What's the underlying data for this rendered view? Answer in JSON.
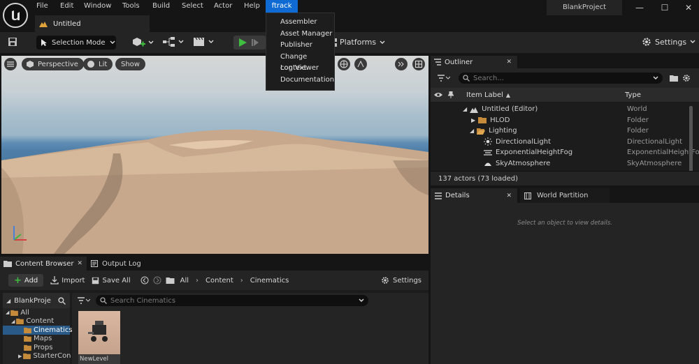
{
  "menu": {
    "items": [
      "File",
      "Edit",
      "Window",
      "Tools",
      "Build",
      "Select",
      "Actor",
      "Help",
      "ftrack"
    ],
    "active": "ftrack"
  },
  "tab": {
    "title": "Untitled"
  },
  "project": {
    "name": "BlankProject"
  },
  "toolbar": {
    "selection_mode": "Selection Mode",
    "platforms": "Platforms",
    "settings": "Settings"
  },
  "viewport": {
    "perspective": "Perspective",
    "lit": "Lit",
    "show": "Show"
  },
  "ftrack_menu": {
    "items": [
      "Assembler",
      "Asset Manager",
      "Publisher",
      "Change context",
      "Log Viewer",
      "Documentation"
    ]
  },
  "outliner": {
    "tab": "Outliner",
    "search_placeholder": "Search...",
    "col_label": "Item Label",
    "col_type": "Type",
    "rows": [
      {
        "label": "Untitled (Editor)",
        "type": "World"
      },
      {
        "label": "HLOD",
        "type": "Folder"
      },
      {
        "label": "Lighting",
        "type": "Folder"
      },
      {
        "label": "DirectionalLight",
        "type": "DirectionalLight"
      },
      {
        "label": "ExponentialHeightFog",
        "type": "ExponentialHeightFo"
      },
      {
        "label": "SkyAtmosphere",
        "type": "SkyAtmosphere"
      }
    ],
    "status": "137 actors (73 loaded)"
  },
  "details": {
    "tab": "Details",
    "tab2": "World Partition",
    "empty_text": "Select an object to view details."
  },
  "content_browser": {
    "tab": "Content Browser",
    "tab2": "Output Log",
    "add": "Add",
    "import": "Import",
    "save_all": "Save All",
    "path": [
      "All",
      "Content",
      "Cinematics"
    ],
    "settings": "Settings",
    "project_label": "BlankProje",
    "search_placeholder": "Search Cinematics",
    "tree": [
      "All",
      "Content",
      "Cinematics",
      "Maps",
      "Props",
      "StarterCon"
    ],
    "asset": "NewLevel"
  }
}
